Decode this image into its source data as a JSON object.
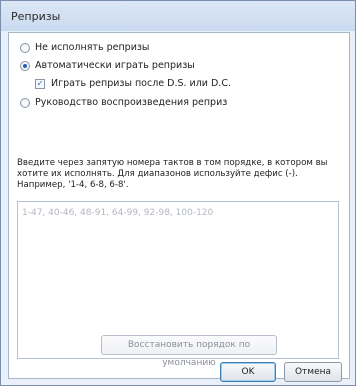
{
  "window": {
    "title": "Репризы"
  },
  "options": {
    "no_repeats": "Не исполнять репризы",
    "auto_play": "Автоматически играть репризы",
    "after_ds_dc": "Играть репризы после D.S. или D.C.",
    "guide": "Руководство воспроизведения реприз"
  },
  "state": {
    "selected": "auto_play",
    "after_ds_dc_checked": true
  },
  "hint_text": "Введите через запятую номера тактов в том порядке, в котором вы хотите их исполнять. Для диапазонов используйте дефис (-). Например, '1-4, 6-8, 6-8'.",
  "order_field": {
    "placeholder": "1-47, 40-46, 48-91, 64-99, 92-98, 100-120"
  },
  "buttons": {
    "reset": "Восстановить порядок по умолчанию",
    "ok": "OK",
    "cancel": "Отмена"
  }
}
